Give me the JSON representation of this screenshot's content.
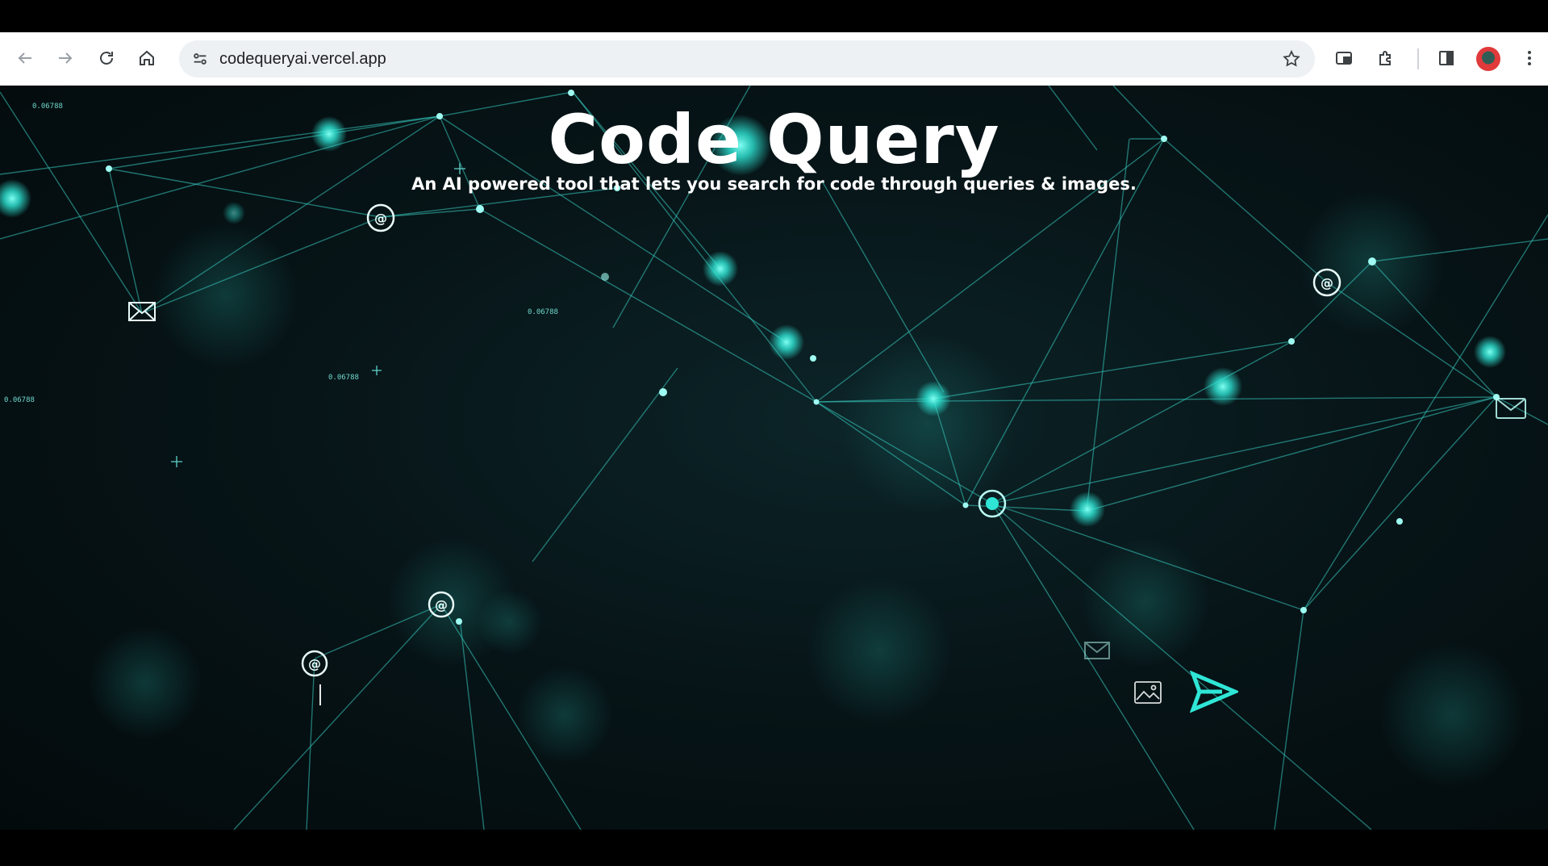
{
  "browser": {
    "url": "codequeryai.vercel.app"
  },
  "hero": {
    "title": "Code Query",
    "subtitle": "An AI powered tool that lets you search for code through queries & images."
  },
  "search": {
    "value": "",
    "placeholder": ""
  },
  "background_labels": [
    "0.06788",
    "0.06788",
    "0.06788",
    "0.06788"
  ],
  "colors": {
    "accent": "#2fe6d6",
    "background": "#061214",
    "text": "#ffffff"
  },
  "icons": {
    "back": "arrow-left-icon",
    "forward": "arrow-right-icon",
    "reload": "reload-icon",
    "home": "home-icon",
    "site_info": "tune-icon",
    "bookmark": "star-icon",
    "pip": "picture-in-picture-icon",
    "extensions": "puzzle-icon",
    "side_panel": "side-panel-icon",
    "menu": "kebab-menu-icon",
    "image_upload": "image-icon",
    "send": "send-icon"
  }
}
